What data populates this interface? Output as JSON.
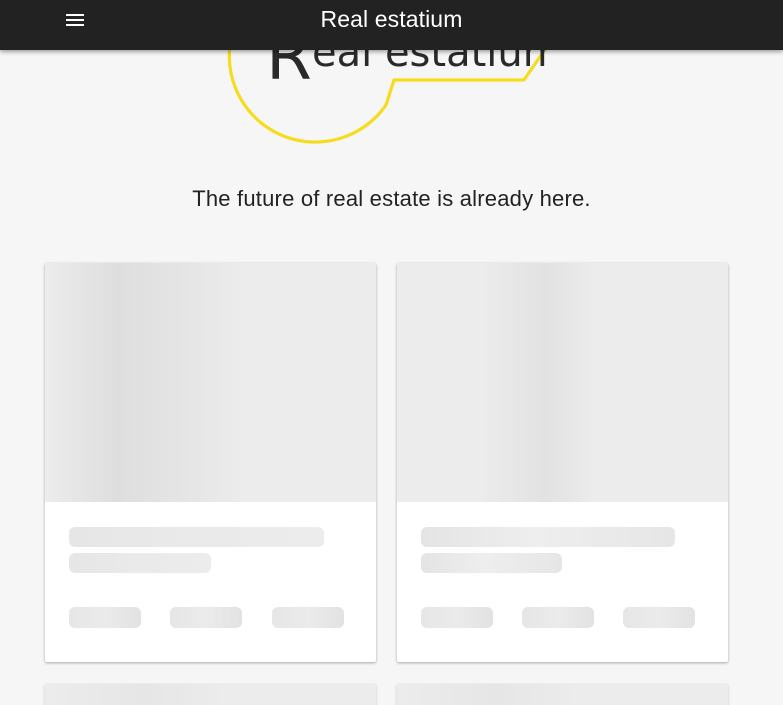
{
  "appbar": {
    "title": "Real estatium",
    "menu_icon": "menu-icon"
  },
  "logo": {
    "text": "Real estatium",
    "accent_color": "#f5dc1c"
  },
  "hero": {
    "tagline": "The future of real estate is already here."
  },
  "listings": {
    "state": "loading-skeleton",
    "cards_visible": 2,
    "cards_partially_visible": 2
  },
  "colors": {
    "appbar_bg": "#222222",
    "page_bg": "#f6f6f6",
    "logo_yellow": "#f5dc1c",
    "skeleton": "#ececec"
  }
}
